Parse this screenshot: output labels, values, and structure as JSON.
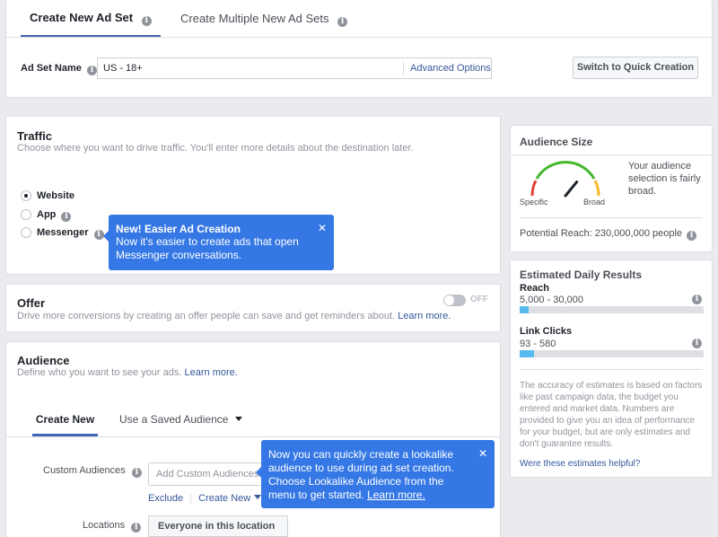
{
  "top": {
    "tabs": [
      {
        "label": "Create New Ad Set",
        "active": true
      },
      {
        "label": "Create Multiple New Ad Sets",
        "active": false
      }
    ],
    "adset_name_label": "Ad Set Name",
    "adset_name_value": "US - 18+",
    "advanced_options": "Advanced Options",
    "switch_button": "Switch to Quick Creation"
  },
  "traffic": {
    "title": "Traffic",
    "description": "Choose where you want to drive traffic. You'll enter more details about the destination later.",
    "options": [
      {
        "label": "Website",
        "selected": true
      },
      {
        "label": "App",
        "selected": false
      },
      {
        "label": "Messenger",
        "selected": false
      }
    ]
  },
  "tooltip_messenger": {
    "title": "New! Easier Ad Creation",
    "body": "Now it's easier to create ads that open Messenger conversations."
  },
  "offer": {
    "title": "Offer",
    "description": "Drive more conversions by creating an offer people can save and get reminders about.",
    "learn_more": "Learn more.",
    "toggle_label": "OFF"
  },
  "audience": {
    "title": "Audience",
    "description": "Define who you want to see your ads.",
    "learn_more": "Learn more.",
    "tabs": [
      {
        "label": "Create New",
        "active": true
      },
      {
        "label": "Use a Saved Audience",
        "active": false
      }
    ],
    "custom_audiences_label": "Custom Audiences",
    "custom_audiences_placeholder": "Add Custom Audiences or",
    "exclude": "Exclude",
    "create_new": "Create New",
    "locations_label": "Locations",
    "locations_value": "Everyone in this location"
  },
  "tooltip_lookalike": {
    "body": "Now you can quickly create a lookalike audience to use during ad set creation. Choose Lookalike Audience from the menu to get started.",
    "learn_more": "Learn more."
  },
  "audience_size": {
    "title": "Audience Size",
    "gauge_left": "Specific",
    "gauge_right": "Broad",
    "gauge_level": 0.72,
    "description": "Your audience selection is fairly broad.",
    "potential_reach": "Potential Reach: 230,000,000 people"
  },
  "daily_results": {
    "title": "Estimated Daily Results",
    "metrics": [
      {
        "label": "Reach",
        "value": "5,000 - 30,000",
        "fill": 0.05
      },
      {
        "label": "Link Clicks",
        "value": "93 - 580",
        "fill": 0.08
      }
    ],
    "disclaimer": "The accuracy of estimates is based on factors like past campaign data, the budget you entered and market data. Numbers are provided to give you an idea of performance for your budget, but are only estimates and don't guarantee results.",
    "helpful_link": "Were these estimates helpful?"
  },
  "colors": {
    "accent": "#4267b2",
    "tooltip": "#3578e5",
    "bar_fill": "#57bbed"
  }
}
